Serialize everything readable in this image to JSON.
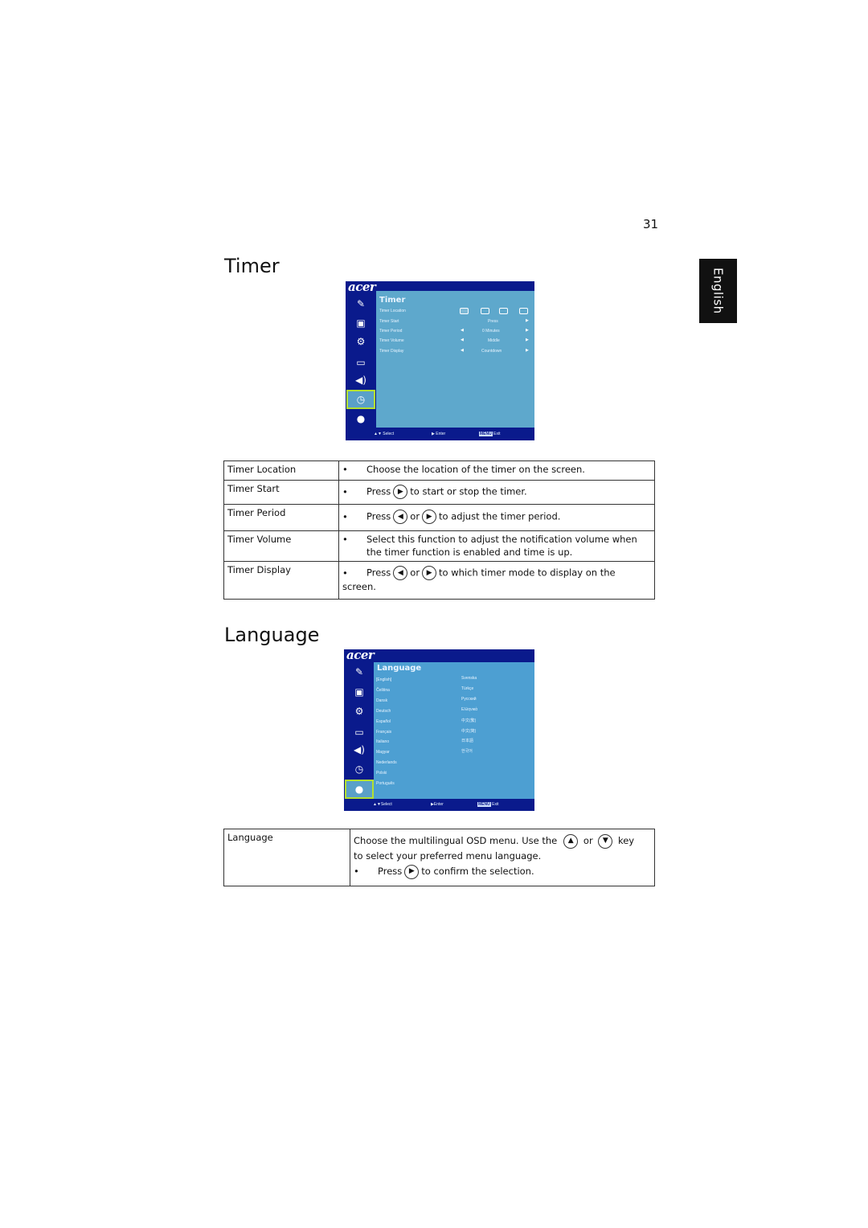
{
  "page": {
    "number": "31",
    "language_tab": "English"
  },
  "timer_section": {
    "title": "Timer",
    "osd": {
      "logo": "acer",
      "heading": "Timer",
      "sidebar_icons": [
        "color-icon",
        "image-icon",
        "management-icon",
        "setting-icon",
        "audio-icon",
        "timer-icon",
        "language-icon"
      ],
      "selected_icon": "timer-icon",
      "rows": [
        {
          "label": "Timer Location",
          "value": ""
        },
        {
          "label": "Timer Start",
          "value": "Press"
        },
        {
          "label": "Timer Period",
          "value": "0  Minutes"
        },
        {
          "label": "Timer Volume",
          "value": "Middle"
        },
        {
          "label": "Timer Display",
          "value": "Countdown"
        }
      ],
      "footer": {
        "select": "Select",
        "enter": "Enter",
        "menu_key": "MENU",
        "exit": "Exit"
      }
    },
    "table": [
      {
        "name": "Timer Location",
        "desc": "Choose the location of the timer on the screen."
      },
      {
        "name": "Timer Start",
        "desc_pre": "Press",
        "desc_post": "to start or stop the timer."
      },
      {
        "name": "Timer Period",
        "desc_pre": "Press",
        "or": "or",
        "desc_post": "to adjust the timer period."
      },
      {
        "name": "Timer Volume",
        "desc": "Select this function to adjust the notification volume when the timer function is enabled and time is up."
      },
      {
        "name": "Timer Display",
        "desc_pre": "Press",
        "or": "or",
        "desc_post": "to which timer mode to display on the screen."
      }
    ]
  },
  "language_section": {
    "title": "Language",
    "osd": {
      "logo": "acer",
      "heading": "Language",
      "selected_icon": "language-icon",
      "col1": [
        "[English]",
        "Čeština",
        "Dansk",
        "Deutsch",
        "Español",
        "Français",
        "Italiano",
        "Magyar",
        "Nederlands",
        "Polski",
        "Português"
      ],
      "col2": [
        "Svenska",
        "Türkçe",
        "Русский",
        "Ελληνικά",
        "中文(繁)",
        "中文(简)",
        "日本語",
        "한국어"
      ],
      "footer": {
        "select": "Select",
        "enter": "Enter",
        "menu_key": "MENU",
        "exit": "Exit"
      }
    },
    "table": {
      "name": "Language",
      "line1_pre": "Choose the multilingual OSD menu. Use the",
      "or": "or",
      "line1_post": "key",
      "line2": "to select your preferred menu language.",
      "bullet_pre": "Press",
      "bullet_post": "to confirm the selection."
    }
  }
}
